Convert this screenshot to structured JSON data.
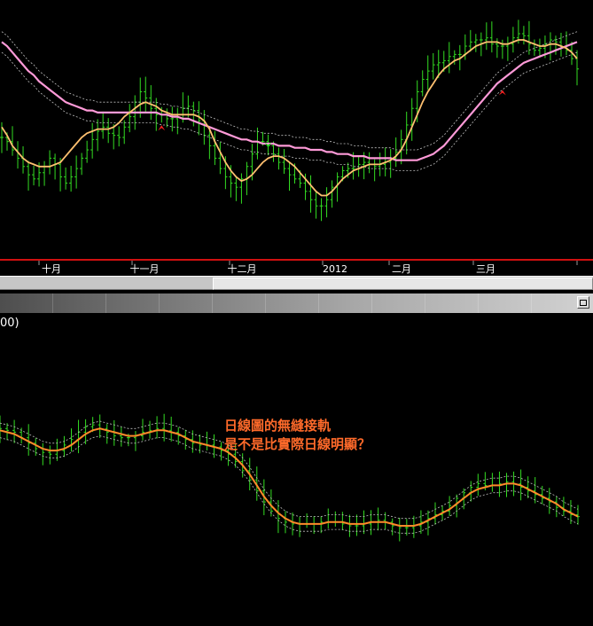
{
  "chart_data": [
    {
      "type": "ohlc",
      "panel": "main-price",
      "x_ticks": [
        "十月",
        "十一月",
        "十二月",
        "2012",
        "二月",
        "三月"
      ],
      "y_range": [
        0,
        100
      ],
      "grid": false,
      "markers": [
        {
          "kind": "buy-arrow",
          "bar": 30
        },
        {
          "kind": "sell-arrow",
          "bar": 50
        },
        {
          "kind": "buy-arrow",
          "bar": 94
        }
      ],
      "series": [
        {
          "role": "bars",
          "color": "#33dd22"
        },
        {
          "role": "short-ma",
          "color": "#ffc070"
        },
        {
          "role": "long-ma",
          "color": "#ff9ad8"
        }
      ],
      "closes": [
        50,
        48,
        44,
        40,
        36,
        32,
        30,
        33,
        36,
        40,
        37,
        31,
        28,
        31,
        35,
        40,
        44,
        49,
        53,
        55,
        52,
        51,
        50,
        55,
        60,
        67,
        72,
        69,
        64,
        61,
        61,
        59,
        59,
        61,
        64,
        65,
        63,
        58,
        51,
        46,
        40,
        35,
        31,
        28,
        26,
        30,
        36,
        42,
        48,
        48,
        46,
        42,
        38,
        35,
        32,
        30,
        28,
        24,
        20,
        17,
        17,
        20,
        26,
        31,
        34,
        35,
        35,
        37,
        38,
        37,
        36,
        37,
        38,
        40,
        43,
        49,
        56,
        64,
        72,
        78,
        82,
        85,
        86,
        87,
        89,
        90,
        90,
        94,
        96,
        97,
        97,
        98,
        95,
        94,
        94,
        95,
        98,
        100,
        99,
        95,
        92,
        93,
        95,
        97,
        96,
        94,
        92,
        88,
        83
      ],
      "short_ma": [
        55,
        51,
        46,
        43,
        40,
        38,
        37,
        36,
        36,
        36,
        37,
        38,
        41,
        44,
        47,
        50,
        52,
        53,
        54,
        54,
        54,
        55,
        57,
        60,
        62,
        64,
        66,
        67,
        66,
        65,
        63,
        62,
        61,
        61,
        61,
        61,
        61,
        60,
        58,
        54,
        48,
        43,
        38,
        34,
        31,
        29,
        30,
        32,
        35,
        38,
        40,
        41,
        41,
        40,
        38,
        36,
        33,
        30,
        27,
        24,
        22,
        22,
        24,
        27,
        30,
        32,
        34,
        35,
        36,
        37,
        37,
        37,
        38,
        39,
        41,
        44,
        49,
        55,
        61,
        67,
        72,
        76,
        80,
        83,
        85,
        87,
        88,
        90,
        92,
        94,
        95,
        96,
        96,
        96,
        95,
        95,
        96,
        97,
        97,
        96,
        95,
        94,
        94,
        95,
        95,
        94,
        93,
        91,
        88
      ],
      "long_ma": [
        96,
        94,
        91,
        88,
        85,
        82,
        80,
        77,
        75,
        73,
        71,
        69,
        67,
        66,
        65,
        64,
        63,
        63,
        62,
        62,
        62,
        62,
        62,
        62,
        62,
        62,
        62,
        62,
        62,
        62,
        61,
        61,
        60,
        60,
        59,
        59,
        58,
        57,
        56,
        55,
        54,
        53,
        52,
        51,
        50,
        49,
        49,
        48,
        48,
        47,
        47,
        47,
        46,
        46,
        46,
        45,
        45,
        45,
        44,
        44,
        44,
        43,
        43,
        42,
        42,
        42,
        41,
        41,
        41,
        40,
        40,
        40,
        40,
        40,
        39,
        39,
        39,
        39,
        39,
        40,
        41,
        42,
        44,
        46,
        49,
        52,
        55,
        58,
        61,
        64,
        67,
        70,
        73,
        76,
        78,
        80,
        82,
        84,
        86,
        87,
        88,
        89,
        90,
        91,
        92,
        93,
        94,
        95,
        96
      ]
    },
    {
      "type": "ohlc",
      "panel": "secondary",
      "series": [
        {
          "role": "bars",
          "color": "#33dd22"
        },
        {
          "role": "moving-average",
          "color": "#ff8a2a"
        }
      ],
      "closes": [
        96,
        95,
        94,
        91,
        88,
        85,
        83,
        82,
        84,
        87,
        90,
        94,
        97,
        98,
        96,
        94,
        92,
        91,
        91,
        92,
        94,
        95,
        96,
        95,
        94,
        92,
        90,
        88,
        87,
        87,
        86,
        84,
        82,
        78,
        73,
        68,
        62,
        56,
        51,
        47,
        45,
        44,
        44,
        44,
        44,
        45,
        45,
        45,
        44,
        43,
        43,
        44,
        45,
        46,
        45,
        43,
        42,
        42,
        43,
        45,
        47,
        49,
        51,
        54,
        58,
        61,
        64,
        66,
        65,
        65,
        66,
        67,
        66,
        64,
        62,
        60,
        58,
        56,
        53,
        51,
        49,
        48
      ],
      "ma": [
        95,
        94,
        93,
        91,
        89,
        87,
        85,
        84,
        84,
        85,
        87,
        90,
        93,
        95,
        96,
        95,
        94,
        93,
        92,
        92,
        93,
        94,
        95,
        95,
        94,
        93,
        91,
        89,
        88,
        87,
        86,
        85,
        83,
        80,
        76,
        71,
        65,
        59,
        54,
        50,
        47,
        45,
        44,
        44,
        44,
        44,
        45,
        45,
        45,
        44,
        44,
        44,
        45,
        45,
        45,
        44,
        43,
        43,
        43,
        44,
        46,
        48,
        50,
        52,
        55,
        58,
        61,
        63,
        64,
        65,
        65,
        66,
        66,
        65,
        63,
        61,
        59,
        57,
        55,
        52,
        50,
        48
      ]
    }
  ],
  "panel_label": "00)",
  "annotation": {
    "line1": "日線圖的無縫接軌",
    "line2": "是不是比實際日線明顯？"
  }
}
